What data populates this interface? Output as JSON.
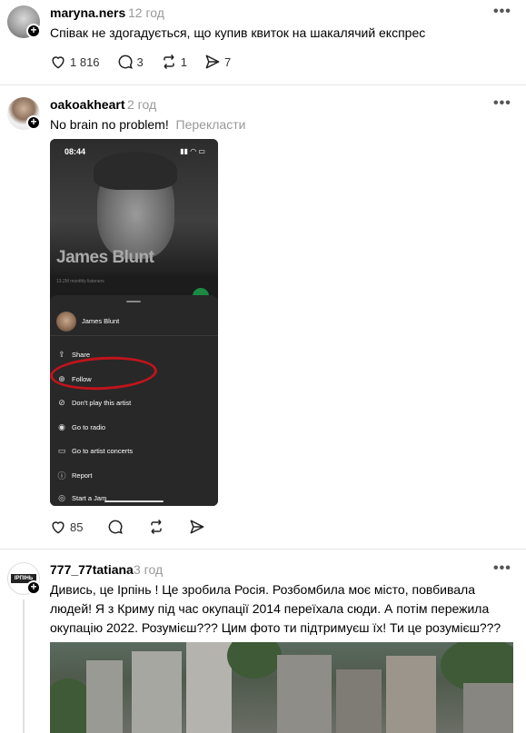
{
  "posts": [
    {
      "username": "maryna.ners",
      "time": "12 год",
      "text": "Співак не здогадується, що купив квиток на шакалячий експрес",
      "likes": "1 816",
      "comments": "3",
      "reposts": "1",
      "shares": "7"
    },
    {
      "username": "oakoakheart",
      "time": "2 год",
      "text": "No brain no problem!",
      "translate": "Перекласти",
      "likes": "85",
      "phone": {
        "clock": "08:44",
        "artist_banner": "James Blunt",
        "listeners": "13.2M monthly listeners",
        "sheet_artist": "James Blunt",
        "menu": [
          {
            "icon": "share-icon",
            "glyph": "⇪",
            "label": "Share"
          },
          {
            "icon": "follow-icon",
            "glyph": "⊕",
            "label": "Follow"
          },
          {
            "icon": "block-icon",
            "glyph": "⊘",
            "label": "Don't play this artist"
          },
          {
            "icon": "radio-icon",
            "glyph": "◉",
            "label": "Go to radio"
          },
          {
            "icon": "ticket-icon",
            "glyph": "▭",
            "label": "Go to artist concerts"
          },
          {
            "icon": "report-icon",
            "glyph": "ⓘ",
            "label": "Report"
          },
          {
            "icon": "jam-icon",
            "glyph": "◎",
            "label": "Start a Jam"
          }
        ]
      }
    },
    {
      "username": "777_77tatiana",
      "time": "3 год",
      "avatar_text": "ІРПІНЬ",
      "text_lines": [
        "Дивись, це Ірпінь ! Це зробила Росія. Розбомбила моє місто, повбивала",
        "людей! Я з Криму під час окупації 2014 переїхала сюди. А потім пережила",
        "окупацію 2022. Розумієш??? Цим фото ти підтримуєш їх! Ти це розумієш???"
      ]
    }
  ],
  "more_label": "•••",
  "plus_label": "+"
}
